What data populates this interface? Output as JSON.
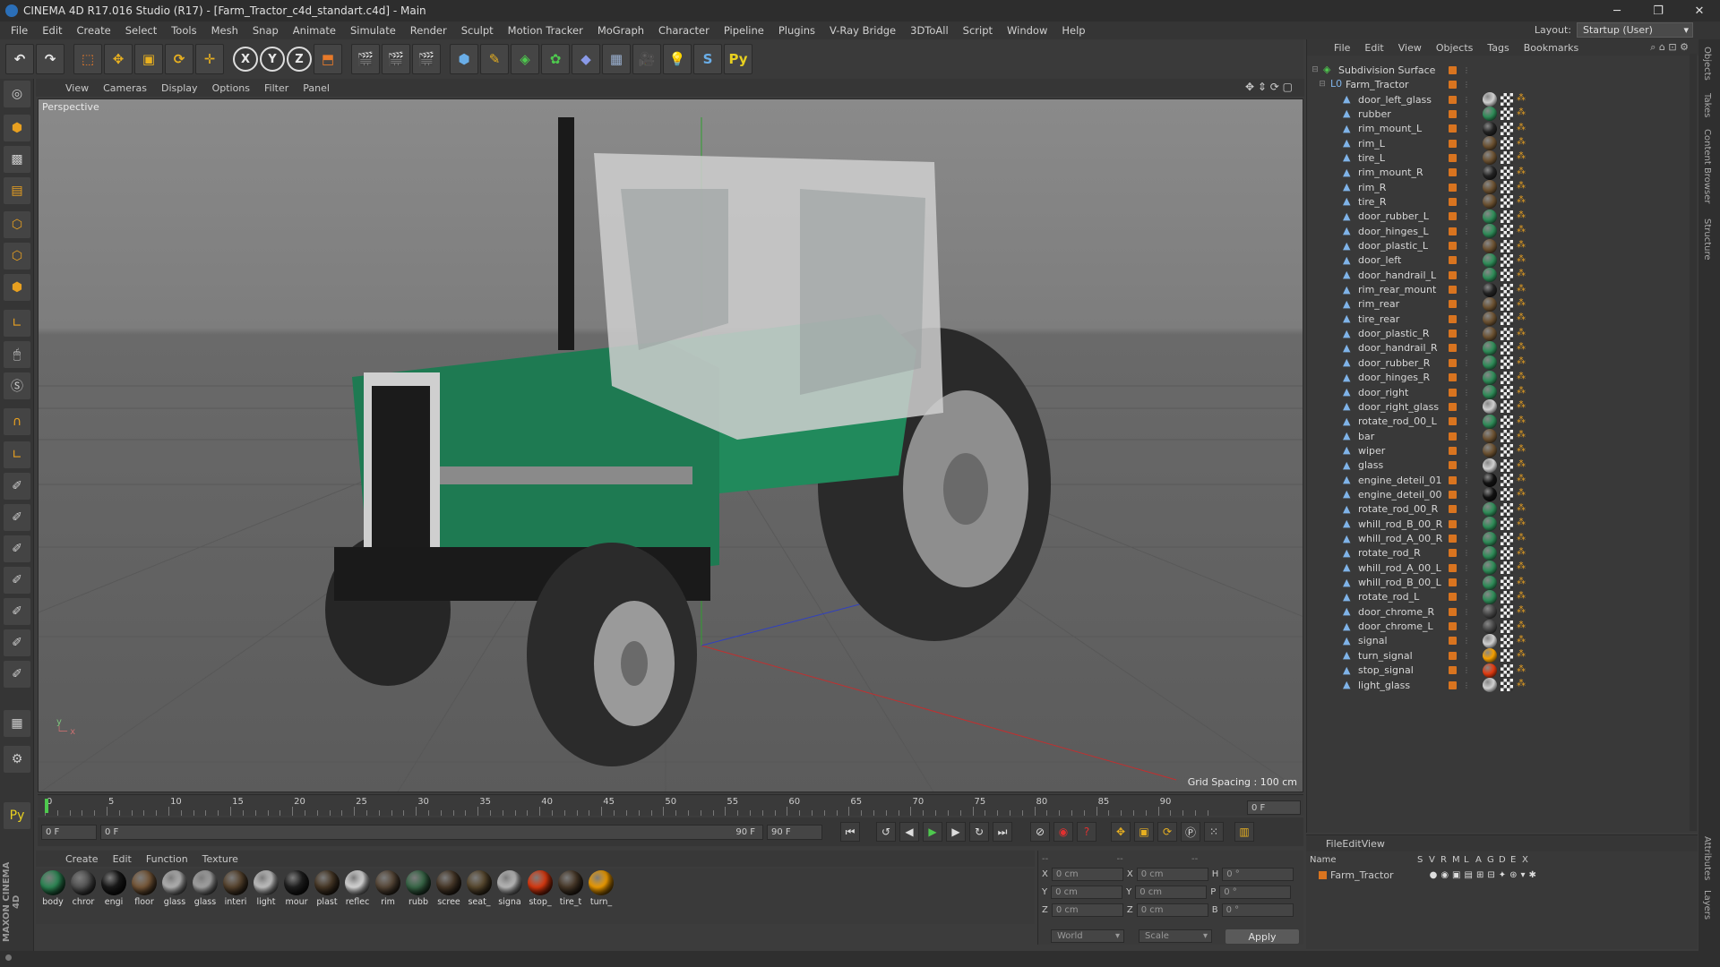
{
  "window": {
    "title": "CINEMA 4D R17.016 Studio (R17) - [Farm_Tractor_c4d_standart.c4d] - Main",
    "controls": [
      "─",
      "❐",
      "✕"
    ]
  },
  "menubar": [
    "File",
    "Edit",
    "Create",
    "Select",
    "Tools",
    "Mesh",
    "Snap",
    "Animate",
    "Simulate",
    "Render",
    "Sculpt",
    "Motion Tracker",
    "MoGraph",
    "Character",
    "Pipeline",
    "Plugins",
    "V-Ray Bridge",
    "3DToAll",
    "Script",
    "Window",
    "Help"
  ],
  "layout": {
    "label": "Layout:",
    "value": "Startup (User)"
  },
  "viewport": {
    "menu": [
      "View",
      "Cameras",
      "Display",
      "Options",
      "Filter",
      "Panel"
    ],
    "camera_label": "Perspective",
    "grid_spacing": "Grid Spacing : 100 cm"
  },
  "timeline": {
    "ticks": [
      "0",
      "5",
      "10",
      "15",
      "20",
      "25",
      "30",
      "35",
      "40",
      "45",
      "50",
      "55",
      "60",
      "65",
      "70",
      "75",
      "80",
      "85",
      "90"
    ],
    "end_frame": "0 F"
  },
  "transport": {
    "current_frame": "0 F",
    "range_start": "0 F",
    "range_end": "90 F",
    "max_frame": "90 F"
  },
  "materials": {
    "menu": [
      "Create",
      "Edit",
      "Function",
      "Texture"
    ],
    "items": [
      {
        "label": "body",
        "color": "#2e8b57"
      },
      {
        "label": "chror",
        "color": "#555555"
      },
      {
        "label": "engi",
        "color": "#1a1a1a"
      },
      {
        "label": "floor",
        "color": "#7a5a3a"
      },
      {
        "label": "glass",
        "color": "#b8b8b8"
      },
      {
        "label": "glass",
        "color": "#a8a8a8"
      },
      {
        "label": "interi",
        "color": "#5a4630"
      },
      {
        "label": "light",
        "color": "#c8c8c8"
      },
      {
        "label": "mour",
        "color": "#202020"
      },
      {
        "label": "plast",
        "color": "#4a3a28"
      },
      {
        "label": "reflec",
        "color": "#e0e0e0"
      },
      {
        "label": "rim",
        "color": "#5a4a3a"
      },
      {
        "label": "rubb",
        "color": "#3a6a4a"
      },
      {
        "label": "scree",
        "color": "#4a3a2a"
      },
      {
        "label": "seat_",
        "color": "#5a4a30"
      },
      {
        "label": "signa",
        "color": "#c0c0c0"
      },
      {
        "label": "stop_",
        "color": "#e03a10"
      },
      {
        "label": "tire_t",
        "color": "#4a3a2a"
      },
      {
        "label": "turn_",
        "color": "#f5a000"
      }
    ]
  },
  "coordinates": {
    "rows": [
      {
        "a": "X",
        "av": "0 cm",
        "b": "X",
        "bv": "0 cm",
        "c": "H",
        "cv": "0 °"
      },
      {
        "a": "Y",
        "av": "0 cm",
        "b": "Y",
        "bv": "0 cm",
        "c": "P",
        "cv": "0 °"
      },
      {
        "a": "Z",
        "av": "0 cm",
        "b": "Z",
        "bv": "0 cm",
        "c": "B",
        "cv": "0 °"
      }
    ],
    "space": "World",
    "mode": "Scale",
    "apply": "Apply"
  },
  "object_manager": {
    "menu": [
      "File",
      "Edit",
      "View",
      "Objects",
      "Tags",
      "Bookmarks"
    ],
    "root": "Subdivision Surface",
    "parent": "Farm_Tractor",
    "objects": [
      {
        "name": "door_left_glass",
        "tag": "#cfcfcf"
      },
      {
        "name": "rubber",
        "tag": "#2e8b57"
      },
      {
        "name": "rim_mount_L",
        "tag": "#222222"
      },
      {
        "name": "rim_L",
        "tag": "#6a5030"
      },
      {
        "name": "tire_L",
        "tag": "#6a5030"
      },
      {
        "name": "rim_mount_R",
        "tag": "#222222"
      },
      {
        "name": "rim_R",
        "tag": "#6a5030"
      },
      {
        "name": "tire_R",
        "tag": "#6a5030"
      },
      {
        "name": "door_rubber_L",
        "tag": "#2e8b57"
      },
      {
        "name": "door_hinges_L",
        "tag": "#2e8b57"
      },
      {
        "name": "door_plastic_L",
        "tag": "#6a5030"
      },
      {
        "name": "door_left",
        "tag": "#2e8b57"
      },
      {
        "name": "door_handrail_L",
        "tag": "#2e8b57"
      },
      {
        "name": "rim_rear_mount",
        "tag": "#222222"
      },
      {
        "name": "rim_rear",
        "tag": "#6a5030"
      },
      {
        "name": "tire_rear",
        "tag": "#6a5030"
      },
      {
        "name": "door_plastic_R",
        "tag": "#6a5030"
      },
      {
        "name": "door_handrail_R",
        "tag": "#2e8b57"
      },
      {
        "name": "door_rubber_R",
        "tag": "#2e8b57"
      },
      {
        "name": "door_hinges_R",
        "tag": "#2e8b57"
      },
      {
        "name": "door_right",
        "tag": "#2e8b57"
      },
      {
        "name": "door_right_glass",
        "tag": "#cfcfcf"
      },
      {
        "name": "rotate_rod_00_L",
        "tag": "#2e8b57"
      },
      {
        "name": "bar",
        "tag": "#6a5030"
      },
      {
        "name": "wiper",
        "tag": "#6a5030"
      },
      {
        "name": "glass",
        "tag": "#cfcfcf"
      },
      {
        "name": "engine_deteil_01",
        "tag": "#111111"
      },
      {
        "name": "engine_deteil_00",
        "tag": "#111111"
      },
      {
        "name": "rotate_rod_00_R",
        "tag": "#2e8b57"
      },
      {
        "name": "whill_rod_B_00_R",
        "tag": "#2e8b57"
      },
      {
        "name": "whill_rod_A_00_R",
        "tag": "#2e8b57"
      },
      {
        "name": "rotate_rod_R",
        "tag": "#2e8b57"
      },
      {
        "name": "whill_rod_A_00_L",
        "tag": "#2e8b57"
      },
      {
        "name": "whill_rod_B_00_L",
        "tag": "#2e8b57"
      },
      {
        "name": "rotate_rod_L",
        "tag": "#2e8b57"
      },
      {
        "name": "door_chrome_R",
        "tag": "#444444"
      },
      {
        "name": "door_chrome_L",
        "tag": "#444444"
      },
      {
        "name": "signal",
        "tag": "#cfcfcf"
      },
      {
        "name": "turn_signal",
        "tag": "#f5a000"
      },
      {
        "name": "stop_signal",
        "tag": "#e03a10"
      },
      {
        "name": "light_glass",
        "tag": "#cfcfcf"
      }
    ]
  },
  "layer_manager": {
    "menu": [
      "File",
      "Edit",
      "View"
    ],
    "columns": [
      "Name",
      "S",
      "V",
      "R",
      "M",
      "L",
      "A",
      "G",
      "D",
      "E",
      "X"
    ],
    "layer": "Farm_Tractor"
  },
  "side_tabs": [
    "Objects",
    "Takes",
    "Content Browser",
    "Structure"
  ],
  "side_tabs_bottom": [
    "Attributes",
    "Layers"
  ],
  "logo_text": "MAXON CINEMA 4D"
}
